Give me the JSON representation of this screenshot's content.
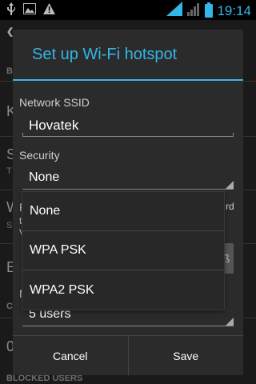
{
  "status_bar": {
    "time": "19:14",
    "left_icons": [
      "usb-icon",
      "image-icon",
      "warning-icon"
    ],
    "right_icons": [
      "wifi-signal-icon",
      "cell-signal-icon",
      "battery-icon"
    ]
  },
  "background": {
    "rows": [
      {
        "letter": "B"
      },
      {
        "letter": "K"
      },
      {
        "letter": "S",
        "sub": "T"
      },
      {
        "letter": "W",
        "sub": "S"
      },
      {
        "letter": "E"
      },
      {
        "letter": "C"
      },
      {
        "letter": "0"
      }
    ],
    "bottom_section": "BLOCKED USERS"
  },
  "dialog": {
    "title": "Set up Wi-Fi hotspot",
    "ssid_label": "Network SSID",
    "ssid_value": "Hovatek",
    "security_label": "Security",
    "security_value": "None",
    "password_fragment_left": "P",
    "password_fragment_right": "rd",
    "frag_t": "t",
    "frag_v": "V",
    "max_users_fragment": "M",
    "max_users_value": "5 users",
    "cancel_label": "Cancel",
    "save_label": "Save"
  },
  "security_options": [
    "None",
    "WPA PSK",
    "WPA2 PSK"
  ]
}
